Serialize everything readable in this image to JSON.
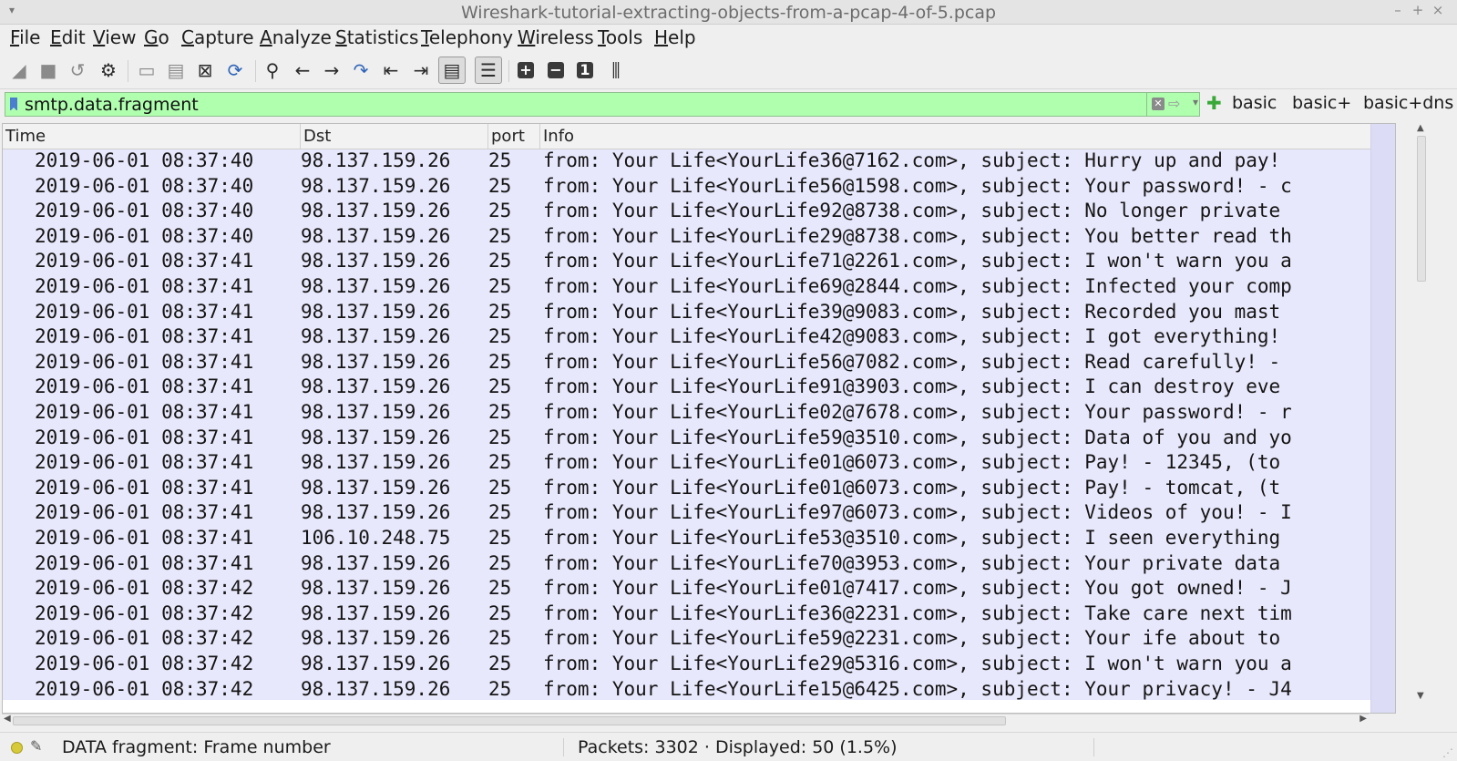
{
  "window": {
    "title": "Wireshark-tutorial-extracting-objects-from-a-pcap-4-of-5.pcap"
  },
  "menu": [
    "File",
    "Edit",
    "View",
    "Go",
    "Capture",
    "Analyze",
    "Statistics",
    "Telephony",
    "Wireless",
    "Tools",
    "Help"
  ],
  "toolbar_icons": [
    "shark-fin-start-icon",
    "stop-capture-icon",
    "restart-capture-icon",
    "capture-options-icon",
    "open-file-icon",
    "save-file-icon",
    "close-file-icon",
    "reload-file-icon",
    "find-packet-icon",
    "go-back-icon",
    "go-forward-icon",
    "go-to-packet-icon",
    "first-packet-icon",
    "last-packet-icon",
    "auto-scroll-icon",
    "colorize-icon",
    "zoom-in-icon",
    "zoom-out-icon",
    "normal-size-icon",
    "resize-columns-icon"
  ],
  "filter": {
    "value": "smtp.data.fragment",
    "buttons": [
      "basic",
      "basic+",
      "basic+dns"
    ]
  },
  "columns": [
    "Time",
    "Dst",
    "port",
    "Info"
  ],
  "packets": [
    {
      "time": "2019-06-01 08:37:40",
      "dst": "98.137.159.26",
      "port": "25",
      "info": "from: Your Life<YourLife36@7162.com>, subject: Hurry up and pay!"
    },
    {
      "time": "2019-06-01 08:37:40",
      "dst": "98.137.159.26",
      "port": "25",
      "info": "from: Your Life<YourLife56@1598.com>, subject: Your password! - c"
    },
    {
      "time": "2019-06-01 08:37:40",
      "dst": "98.137.159.26",
      "port": "25",
      "info": "from: Your Life<YourLife92@8738.com>, subject: No longer private"
    },
    {
      "time": "2019-06-01 08:37:40",
      "dst": "98.137.159.26",
      "port": "25",
      "info": "from: Your Life<YourLife29@8738.com>, subject: You better read th"
    },
    {
      "time": "2019-06-01 08:37:41",
      "dst": "98.137.159.26",
      "port": "25",
      "info": "from: Your Life<YourLife71@2261.com>, subject: I won't warn you a"
    },
    {
      "time": "2019-06-01 08:37:41",
      "dst": "98.137.159.26",
      "port": "25",
      "info": "from: Your Life<YourLife69@2844.com>, subject: Infected your comp"
    },
    {
      "time": "2019-06-01 08:37:41",
      "dst": "98.137.159.26",
      "port": "25",
      "info": "from: Your Life<YourLife39@9083.com>, subject: Recorded you mast"
    },
    {
      "time": "2019-06-01 08:37:41",
      "dst": "98.137.159.26",
      "port": "25",
      "info": "from: Your Life<YourLife42@9083.com>, subject: I got everything!"
    },
    {
      "time": "2019-06-01 08:37:41",
      "dst": "98.137.159.26",
      "port": "25",
      "info": "from: Your Life<YourLife56@7082.com>, subject: Read carefully! -"
    },
    {
      "time": "2019-06-01 08:37:41",
      "dst": "98.137.159.26",
      "port": "25",
      "info": "from: Your Life<YourLife91@3903.com>, subject: I can destroy eve"
    },
    {
      "time": "2019-06-01 08:37:41",
      "dst": "98.137.159.26",
      "port": "25",
      "info": "from: Your Life<YourLife02@7678.com>, subject: Your password! - r"
    },
    {
      "time": "2019-06-01 08:37:41",
      "dst": "98.137.159.26",
      "port": "25",
      "info": "from: Your Life<YourLife59@3510.com>, subject: Data of you and yo"
    },
    {
      "time": "2019-06-01 08:37:41",
      "dst": "98.137.159.26",
      "port": "25",
      "info": "from: Your Life<YourLife01@6073.com>, subject: Pay! - 12345,  (to"
    },
    {
      "time": "2019-06-01 08:37:41",
      "dst": "98.137.159.26",
      "port": "25",
      "info": "from: Your Life<YourLife01@6073.com>, subject: Pay! - tomcat,  (t"
    },
    {
      "time": "2019-06-01 08:37:41",
      "dst": "98.137.159.26",
      "port": "25",
      "info": "from: Your Life<YourLife97@6073.com>, subject: Videos of you! - I"
    },
    {
      "time": "2019-06-01 08:37:41",
      "dst": "106.10.248.75",
      "port": "25",
      "info": "from: Your Life<YourLife53@3510.com>, subject: I seen everything"
    },
    {
      "time": "2019-06-01 08:37:41",
      "dst": "98.137.159.26",
      "port": "25",
      "info": "from: Your Life<YourLife70@3953.com>, subject: Your private data"
    },
    {
      "time": "2019-06-01 08:37:42",
      "dst": "98.137.159.26",
      "port": "25",
      "info": "from: Your Life<YourLife01@7417.com>, subject: You got owned! - J"
    },
    {
      "time": "2019-06-01 08:37:42",
      "dst": "98.137.159.26",
      "port": "25",
      "info": "from: Your Life<YourLife36@2231.com>, subject: Take care next tim"
    },
    {
      "time": "2019-06-01 08:37:42",
      "dst": "98.137.159.26",
      "port": "25",
      "info": "from: Your Life<YourLife59@2231.com>, subject: Your ife about to"
    },
    {
      "time": "2019-06-01 08:37:42",
      "dst": "98.137.159.26",
      "port": "25",
      "info": "from: Your Life<YourLife29@5316.com>, subject: I won't warn you a"
    },
    {
      "time": "2019-06-01 08:37:42",
      "dst": "98.137.159.26",
      "port": "25",
      "info": "from: Your Life<YourLife15@6425.com>, subject: Your privacy! - J4"
    }
  ],
  "status": {
    "field_info": "DATA fragment: Frame number",
    "packets": "Packets: 3302 · Displayed: 50 (1.5%)"
  },
  "colors": {
    "filter_valid": "#afffaf",
    "row_bg": "#e8e8fc"
  }
}
